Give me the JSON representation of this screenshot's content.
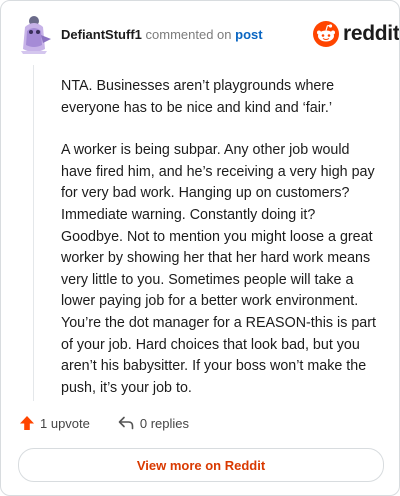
{
  "comment": {
    "username": "DefiantStuff1",
    "action_text": "commented on",
    "post_link": "post",
    "paragraphs": [
      "NTA. Businesses aren’t playgrounds where everyone has to be nice and kind and ‘fair.’",
      "A worker is being subpar. Any other job would have fired him, and he’s receiving a very high pay for very bad work. Hanging up on customers? Immediate warning. Constantly doing it? Goodbye. Not to mention you might loose a great worker by showing her that her hard work means very little to you. Sometimes people will take a lower paying job for a better work environment. You’re the dot manager for a REASON-this is part of your job. Hard choices that look bad, but you aren’t his babysitter. If your boss won’t make the push, it’s your job to."
    ]
  },
  "brand": {
    "logo_text": "reddit",
    "accent": "#ff4500"
  },
  "actions": {
    "upvotes": "1 upvote",
    "replies": "0 replies"
  },
  "footer": {
    "view_more": "View more on Reddit"
  },
  "icons": {
    "avatar": "snoo-avatar-icon",
    "logo": "reddit-logo-icon",
    "upvote": "upvote-arrow-icon",
    "reply": "reply-arrow-icon"
  }
}
